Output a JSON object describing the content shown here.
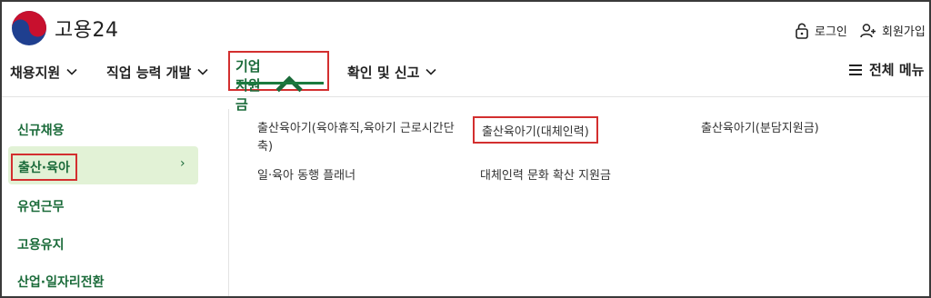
{
  "header": {
    "brand": "고용24",
    "login_label": "로그인",
    "signup_label": "회원가입"
  },
  "nav": {
    "items": [
      {
        "label": "채용지원"
      },
      {
        "label": "직업 능력 개발"
      },
      {
        "label": "기업지원금"
      },
      {
        "label": "확인 및 신고"
      }
    ],
    "active_index": 2,
    "full_menu_label": "전체 메뉴"
  },
  "sidebar": {
    "items": [
      {
        "label": "신규채용"
      },
      {
        "label": "출산·육아"
      },
      {
        "label": "유연근무"
      },
      {
        "label": "고용유지"
      },
      {
        "label": "산업·일자리전환"
      }
    ],
    "active_index": 1,
    "active_arrow": "›"
  },
  "submenu": {
    "links": [
      {
        "label": "출산육아기(육아휴직,육아기 근로시간단"
      },
      {
        "label": "축)"
      },
      {
        "label": "출산육아기(대체인력)"
      },
      {
        "label": "출산육아기(분담지원금)"
      },
      {
        "label": "일·육아 동행 플래너"
      },
      {
        "label": "대체인력 문화 확산 지원금"
      }
    ],
    "highlighted_index": 2
  },
  "colors": {
    "accent_green": "#1b6b3a",
    "active_bg": "#e2f2d6",
    "highlight_border": "#d32f2f"
  },
  "icons": {
    "logo": "taegeuk-logo",
    "login": "lock-icon",
    "signup": "person-add-icon",
    "menu": "hamburger-icon",
    "chevron": "chevron-down-icon"
  }
}
